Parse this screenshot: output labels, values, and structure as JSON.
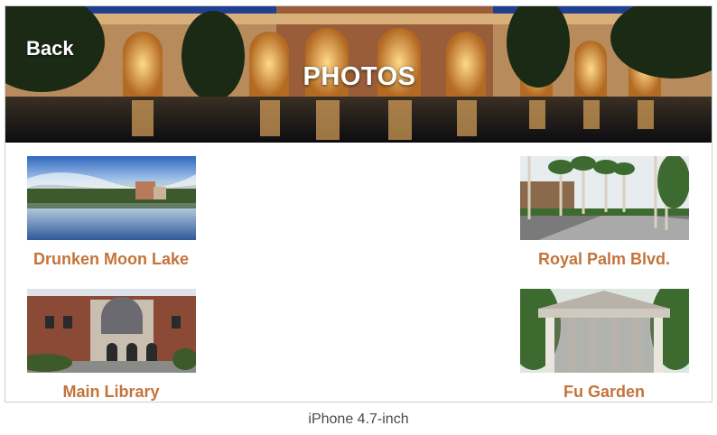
{
  "header": {
    "back_label": "Back",
    "title": "PHOTOS"
  },
  "photos": [
    {
      "caption": "Drunken Moon Lake"
    },
    {
      "caption": "Royal Palm Blvd."
    },
    {
      "caption": "Main Library"
    },
    {
      "caption": "Fu Garden"
    }
  ],
  "footer": {
    "device_label": "iPhone 4.7-inch"
  },
  "colors": {
    "caption": "#c4733a",
    "title": "#ffffff"
  }
}
